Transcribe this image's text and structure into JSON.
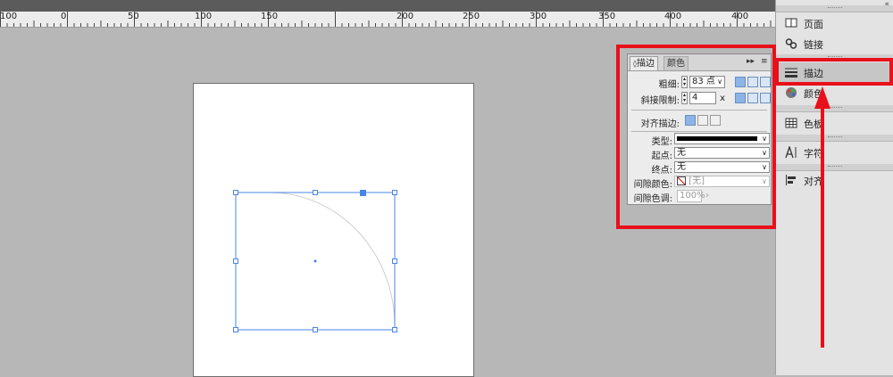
{
  "ruler": {
    "labels": [
      "100",
      "0",
      "50",
      "100",
      "150",
      "200",
      "250",
      "300",
      "350",
      "400"
    ]
  },
  "stroke_panel": {
    "tabs": {
      "stroke": "描边",
      "color": "颜色"
    },
    "expand_glyph": "▸▸",
    "menu_glyph": "≡",
    "weight_label": "粗细:",
    "weight_value": "83 点",
    "miter_label": "斜接限制:",
    "miter_value": "4",
    "miter_unit": "x",
    "align_label": "对齐描边:",
    "type_label": "类型:",
    "start_label": "起点:",
    "start_value": "无",
    "end_label": "终点:",
    "end_value": "无",
    "gap_color_label": "间隙颜色:",
    "gap_color_value": "[无]",
    "gap_tint_label": "间隙色调:",
    "gap_tint_value": "100%"
  },
  "dock": {
    "collapse_glyph": "«",
    "items": [
      {
        "label": "页面",
        "icon": "pages-icon"
      },
      {
        "label": "链接",
        "icon": "links-icon"
      },
      {
        "label": "描边",
        "icon": "stroke-icon"
      },
      {
        "label": "颜色",
        "icon": "color-icon"
      },
      {
        "label": "色板",
        "icon": "swatches-icon"
      },
      {
        "label": "字符",
        "icon": "character-icon"
      },
      {
        "label": "对齐",
        "icon": "align-icon"
      }
    ]
  },
  "colors": {
    "annotation": "#e8101a",
    "selection": "#4a86e8",
    "stroke_type": "#000000"
  }
}
